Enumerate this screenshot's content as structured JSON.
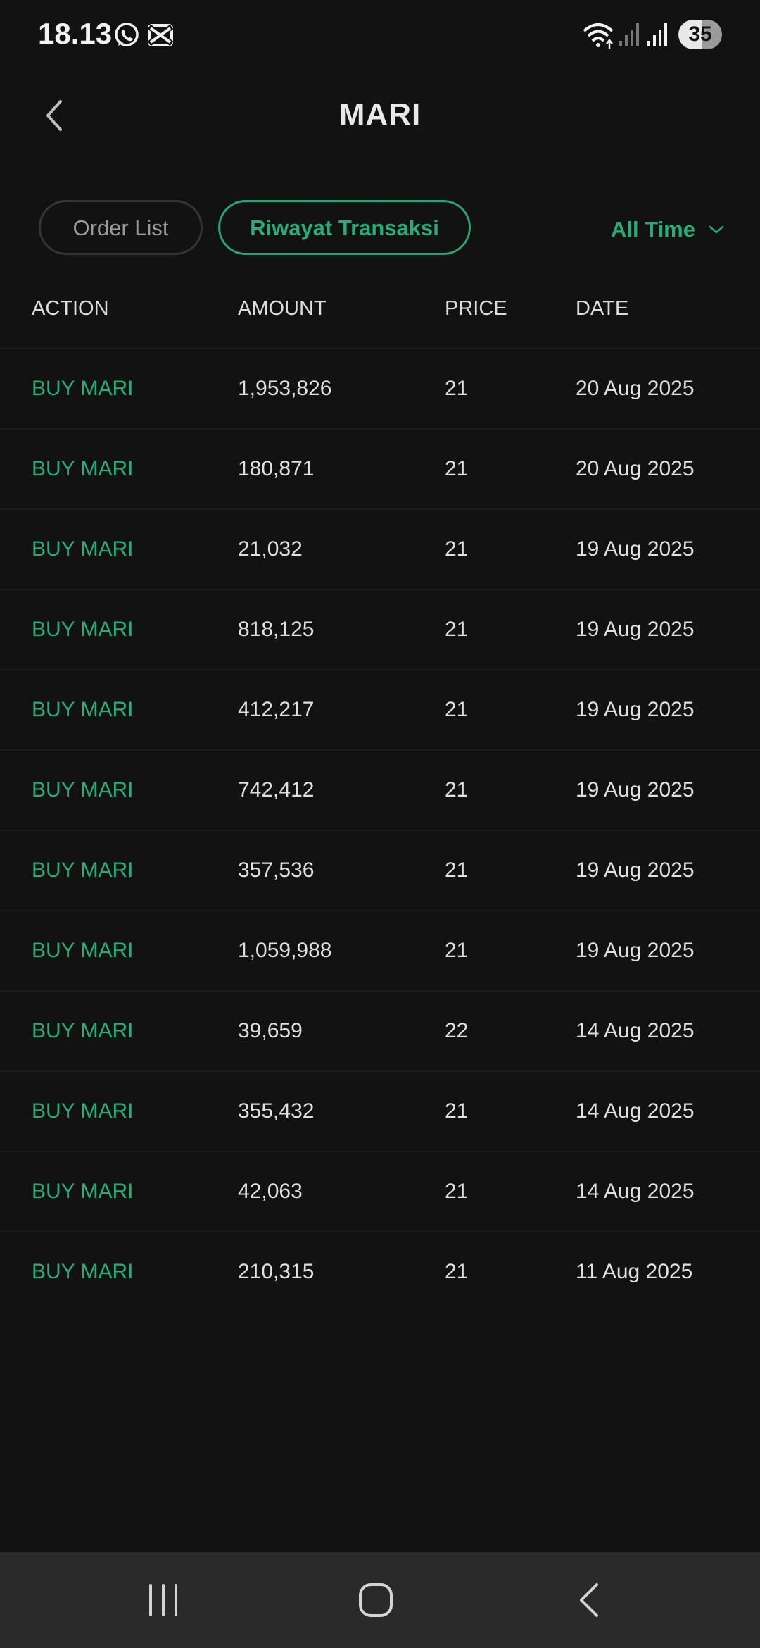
{
  "status_bar": {
    "time": "18.13",
    "battery": "35",
    "icons": [
      "whatsapp-icon",
      "capcut-icon",
      "wifi-icon",
      "signal-sim1-icon",
      "signal-sim2-icon"
    ]
  },
  "header": {
    "title": "MARI",
    "back_icon": "chevron-left-icon"
  },
  "tabs": [
    {
      "label": "Order List",
      "active": false
    },
    {
      "label": "Riwayat Transaksi",
      "active": true
    }
  ],
  "filter": {
    "label": "All Time",
    "icon": "chevron-down-icon"
  },
  "table": {
    "columns": [
      "ACTION",
      "AMOUNT",
      "PRICE",
      "DATE"
    ],
    "rows": [
      {
        "action": "BUY MARI",
        "amount": "1,953,826",
        "price": "21",
        "date": "20 Aug 2025"
      },
      {
        "action": "BUY MARI",
        "amount": "180,871",
        "price": "21",
        "date": "20 Aug 2025"
      },
      {
        "action": "BUY MARI",
        "amount": "21,032",
        "price": "21",
        "date": "19 Aug 2025"
      },
      {
        "action": "BUY MARI",
        "amount": "818,125",
        "price": "21",
        "date": "19 Aug 2025"
      },
      {
        "action": "BUY MARI",
        "amount": "412,217",
        "price": "21",
        "date": "19 Aug 2025"
      },
      {
        "action": "BUY MARI",
        "amount": "742,412",
        "price": "21",
        "date": "19 Aug 2025"
      },
      {
        "action": "BUY MARI",
        "amount": "357,536",
        "price": "21",
        "date": "19 Aug 2025"
      },
      {
        "action": "BUY MARI",
        "amount": "1,059,988",
        "price": "21",
        "date": "19 Aug 2025"
      },
      {
        "action": "BUY MARI",
        "amount": "39,659",
        "price": "22",
        "date": "14 Aug 2025"
      },
      {
        "action": "BUY MARI",
        "amount": "355,432",
        "price": "21",
        "date": "14 Aug 2025"
      },
      {
        "action": "BUY MARI",
        "amount": "42,063",
        "price": "21",
        "date": "14 Aug 2025"
      },
      {
        "action": "BUY MARI",
        "amount": "210,315",
        "price": "21",
        "date": "11 Aug 2025"
      }
    ]
  },
  "nav_bar": {
    "buttons": [
      "recent-apps-icon",
      "home-icon",
      "back-icon"
    ]
  },
  "colors": {
    "background": "#121212",
    "accent": "#27ad77",
    "text": "#e0e0e0",
    "nav_bar": "#2a2a2a"
  }
}
